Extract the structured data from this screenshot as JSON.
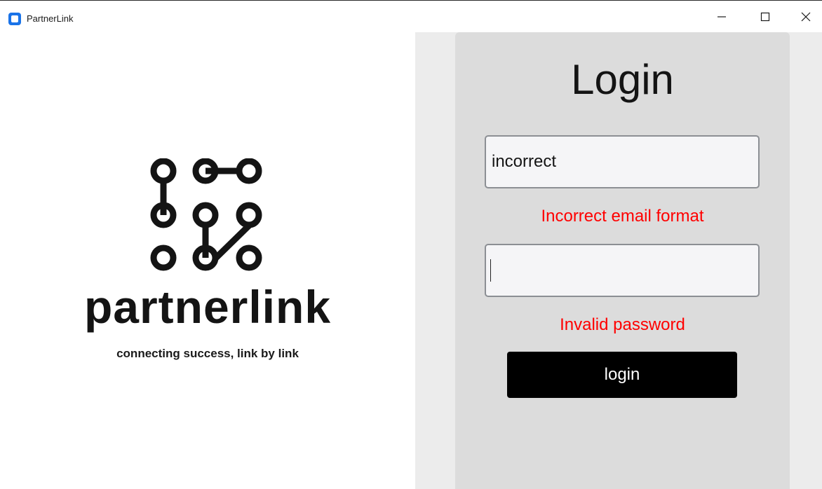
{
  "window": {
    "title": "PartnerLink",
    "controls": [
      "minimize-icon",
      "maximize-icon",
      "close-icon"
    ]
  },
  "brand": {
    "name": "partnerlink",
    "tagline": "connecting success, link by link",
    "logo_icon": "partnerlink-logo-icon"
  },
  "login": {
    "heading": "Login",
    "email_value": "incorrect",
    "email_error": "Incorrect email format",
    "password_value": "",
    "password_error": "Invalid password",
    "button_label": "login"
  },
  "colors": {
    "error": "#ff0000",
    "button": "#000000",
    "card": "#dcdcdc",
    "panel": "#ececec"
  }
}
